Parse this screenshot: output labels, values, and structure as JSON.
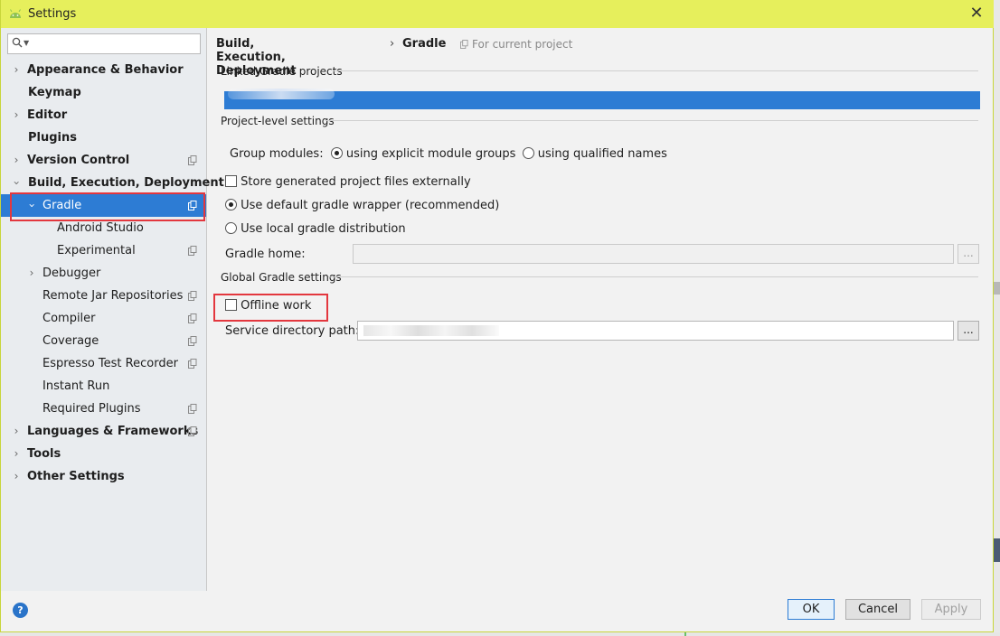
{
  "window": {
    "title": "Settings",
    "close_glyph": "✕"
  },
  "search": {
    "value": "",
    "placeholder": ""
  },
  "sidebar": {
    "items": [
      {
        "label": "Appearance & Behavior"
      },
      {
        "label": "Keymap"
      },
      {
        "label": "Editor"
      },
      {
        "label": "Plugins"
      },
      {
        "label": "Version Control"
      },
      {
        "label": "Build, Execution, Deployment"
      },
      {
        "label": "Gradle"
      },
      {
        "label": "Android Studio"
      },
      {
        "label": "Experimental"
      },
      {
        "label": "Debugger"
      },
      {
        "label": "Remote Jar Repositories"
      },
      {
        "label": "Compiler"
      },
      {
        "label": "Coverage"
      },
      {
        "label": "Espresso Test Recorder"
      },
      {
        "label": "Instant Run"
      },
      {
        "label": "Required Plugins"
      },
      {
        "label": "Languages & Frameworks"
      },
      {
        "label": "Tools"
      },
      {
        "label": "Other Settings"
      }
    ]
  },
  "breadcrumb": {
    "parent": "Build, Execution, Deployment",
    "separator": "›",
    "current": "Gradle",
    "scope": "For current project"
  },
  "sections": {
    "linked": "Linked Gradle projects",
    "project_level": "Project-level settings",
    "global": "Global Gradle settings"
  },
  "group_modules": {
    "label": "Group modules:",
    "option_explicit": "using explicit module groups",
    "option_qualified": "using qualified names",
    "selected": "explicit"
  },
  "options": {
    "store_generated": "Store generated project files externally",
    "use_default_wrapper": "Use default gradle wrapper (recommended)",
    "use_local_distribution": "Use local gradle distribution",
    "gradle_home_label": "Gradle home:",
    "gradle_home_value": "",
    "offline_work": "Offline work",
    "service_dir_label": "Service directory path:",
    "browse_label": "..."
  },
  "buttons": {
    "help": "?",
    "ok": "OK",
    "cancel": "Cancel",
    "apply": "Apply"
  },
  "colors": {
    "titlebar": "#e6ef5c",
    "selection": "#2d7cd4",
    "highlight_box": "#e3373e"
  }
}
